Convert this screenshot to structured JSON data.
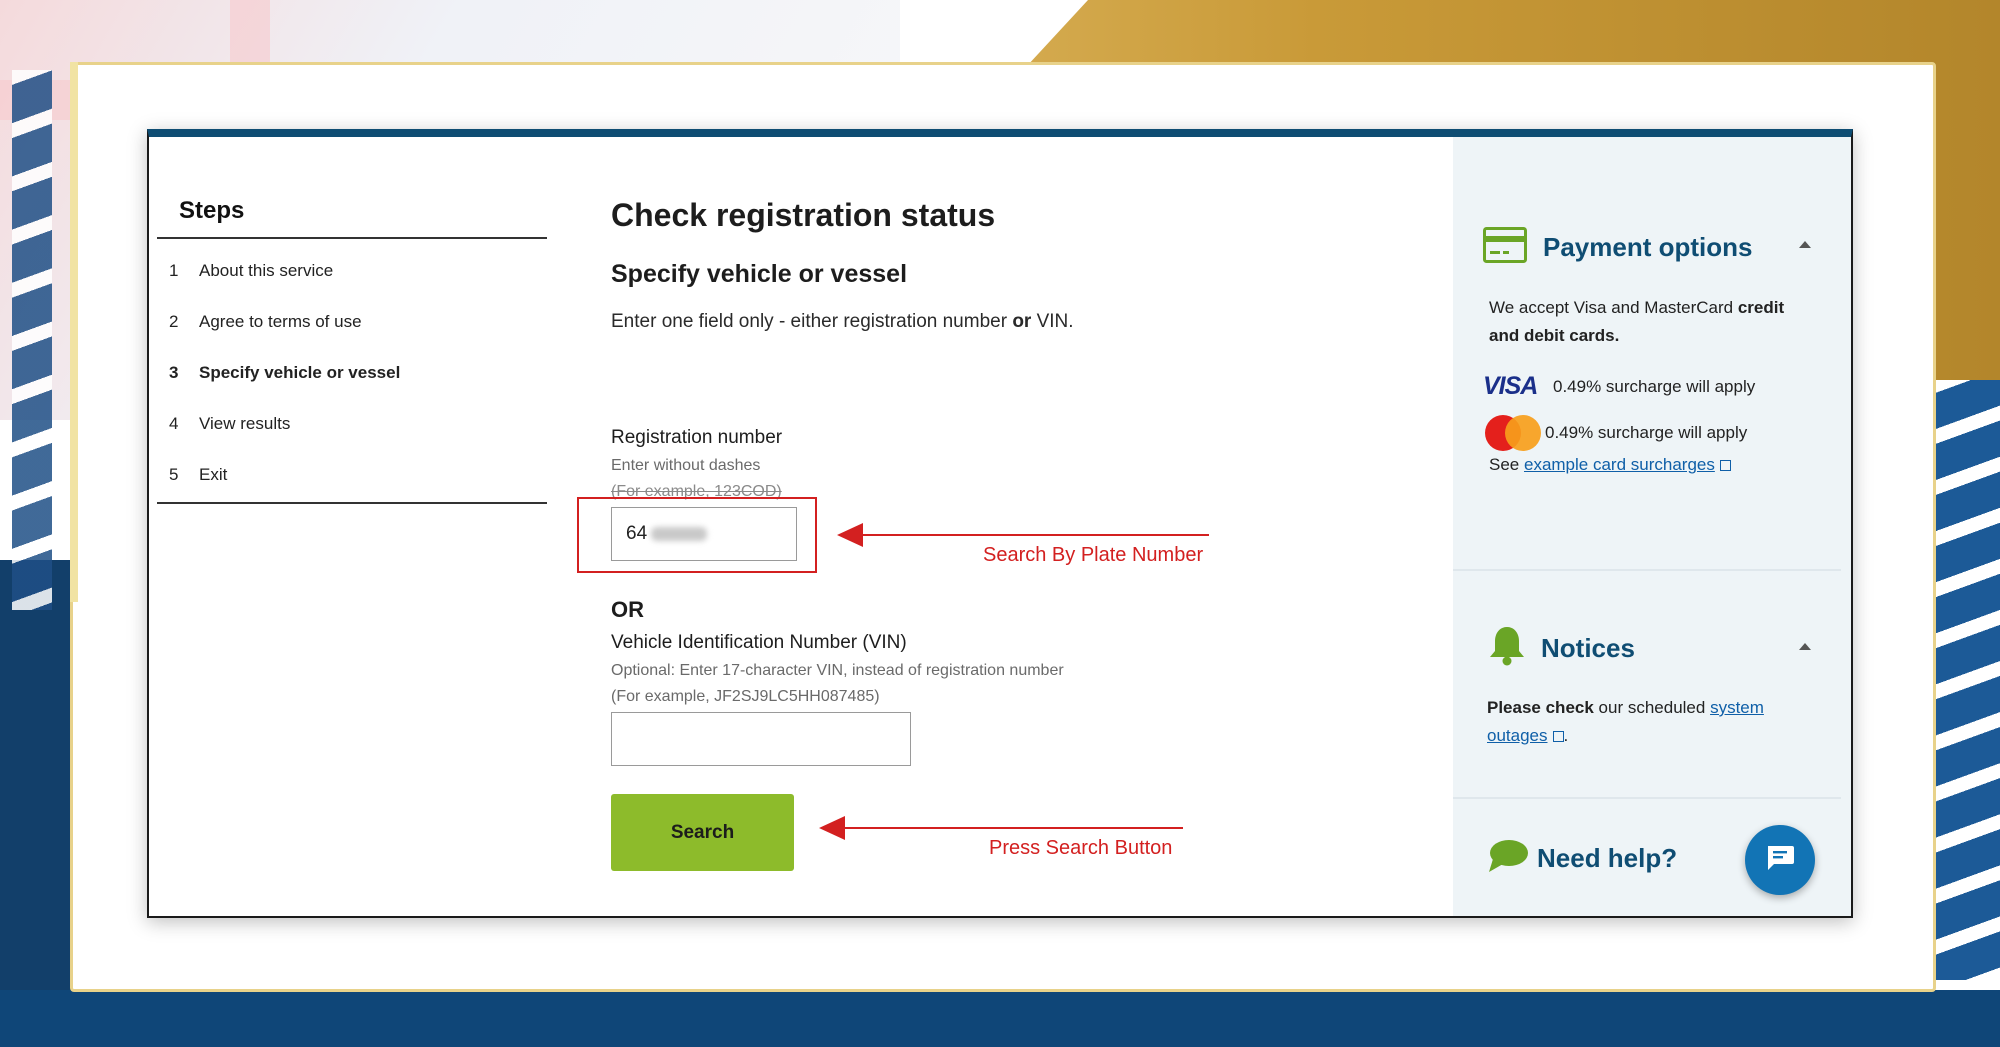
{
  "steps": {
    "title": "Steps",
    "items": [
      {
        "num": "1",
        "label": "About this service"
      },
      {
        "num": "2",
        "label": "Agree to terms of use"
      },
      {
        "num": "3",
        "label": "Specify vehicle or vessel"
      },
      {
        "num": "4",
        "label": "View results"
      },
      {
        "num": "5",
        "label": "Exit"
      }
    ],
    "active_index": 2
  },
  "main": {
    "title": "Check registration status",
    "subtitle": "Specify vehicle or vessel",
    "intro_prefix": "Enter one field only - either registration number ",
    "intro_bold": "or",
    "intro_suffix": " VIN.",
    "registration": {
      "label": "Registration number",
      "hint": "Enter without dashes",
      "example": "(For example, 123COD)",
      "value": "64"
    },
    "or_label": "OR",
    "vin": {
      "label": "Vehicle Identification Number (VIN)",
      "hint": "Optional: Enter 17-character VIN, instead of registration number",
      "example": "(For example, JF2SJ9LC5HH087485)",
      "value": ""
    },
    "search_label": "Search"
  },
  "annotations": {
    "plate": "Search By Plate Number",
    "search": "Press Search Button",
    "color": "#d32020"
  },
  "aside": {
    "payment": {
      "title": "Payment options",
      "accept_prefix": "We accept Visa and MasterCard ",
      "accept_bold": "credit and debit cards.",
      "visa_logo": "VISA",
      "visa_text": "0.49% surcharge will apply",
      "mc_text": "0.49% surcharge will apply",
      "see_prefix": "See ",
      "see_link": "example card surcharges"
    },
    "notices": {
      "title": "Notices",
      "bold": "Please check",
      "text": " our scheduled ",
      "link1": "system",
      "link2": "outages",
      "suffix": "."
    },
    "help": {
      "title": "Need help?"
    }
  },
  "colors": {
    "accent_green": "#8dbb2b",
    "heading_blue": "#0f4d73",
    "icon_green": "#6aa526",
    "chat_blue": "#1274b5"
  }
}
